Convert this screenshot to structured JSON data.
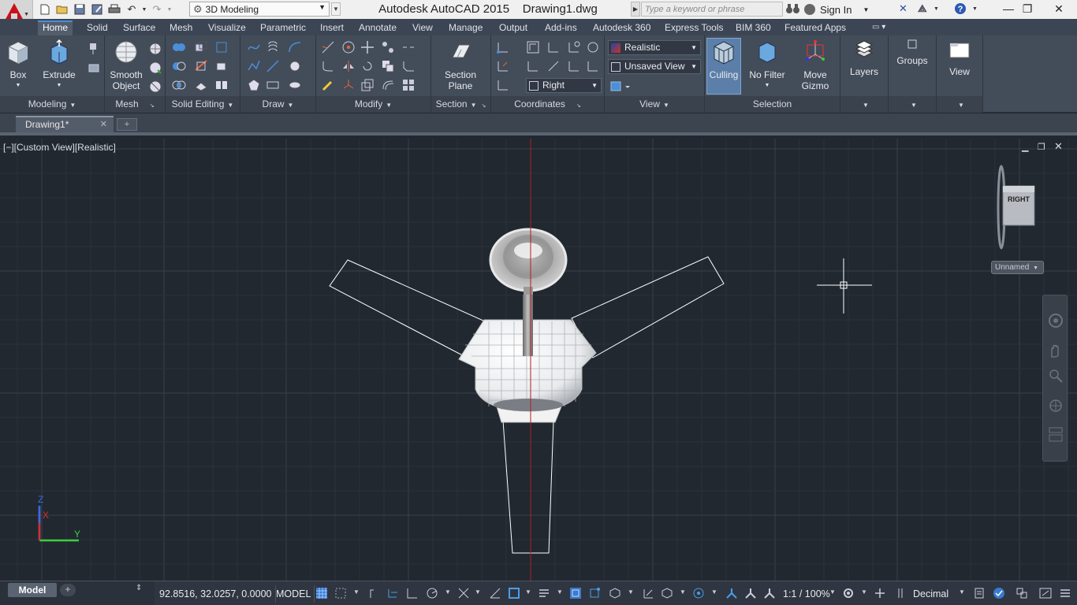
{
  "title_bar": {
    "workspace": "3D Modeling",
    "app_title": "Autodesk AutoCAD 2015    Drawing1.dwg",
    "search_placeholder": "Type a keyword or phrase",
    "sign_in": "Sign In"
  },
  "ribbon": {
    "tabs": [
      "Home",
      "Solid",
      "Surface",
      "Mesh",
      "Visualize",
      "Parametric",
      "Insert",
      "Annotate",
      "View",
      "Manage",
      "Output",
      "Add-ins",
      "Autodesk 360",
      "Express Tools",
      "BIM 360",
      "Featured Apps"
    ],
    "active_tab": "Home",
    "panels": {
      "modeling": {
        "title": "Modeling",
        "box": "Box",
        "extrude": "Extrude"
      },
      "mesh": {
        "title": "Mesh",
        "smooth_object_line1": "Smooth",
        "smooth_object_line2": "Object"
      },
      "solid_editing": {
        "title": "Solid Editing"
      },
      "draw": {
        "title": "Draw"
      },
      "modify": {
        "title": "Modify"
      },
      "section": {
        "title": "Section",
        "section_plane_line1": "Section",
        "section_plane_line2": "Plane"
      },
      "coordinates": {
        "title": "Coordinates",
        "ucs_view": "Right"
      },
      "view": {
        "title": "View",
        "visual_style": "Realistic",
        "named_view": "Unsaved View"
      },
      "selection": {
        "title": "Selection",
        "culling": "Culling",
        "no_filter_line1": "No Filter",
        "move_gizmo_line1": "Move",
        "move_gizmo_line2": "Gizmo"
      },
      "layers": {
        "label": "Layers"
      },
      "groups": {
        "label": "Groups"
      },
      "view_big": {
        "label": "View"
      }
    }
  },
  "document_tabs": {
    "active": "Drawing1*"
  },
  "viewport": {
    "label": "[−][Custom View][Realistic]",
    "viewcube_face": "RIGHT",
    "ucs_menu": "Unnamed",
    "axis_x": "X",
    "axis_y": "Y",
    "axis_z": "Z"
  },
  "status_bar": {
    "model_tab": "Model",
    "coordinates": "92.8516, 32.0257, 0.0000",
    "space": "MODEL",
    "annotation_scale": "1:1 / 100%",
    "units": "Decimal"
  },
  "colors": {
    "accent": "#4a8fd8",
    "viewport_bg": "#212830",
    "ribbon_bg": "#434c59",
    "autocad_red": "#c8111a"
  }
}
